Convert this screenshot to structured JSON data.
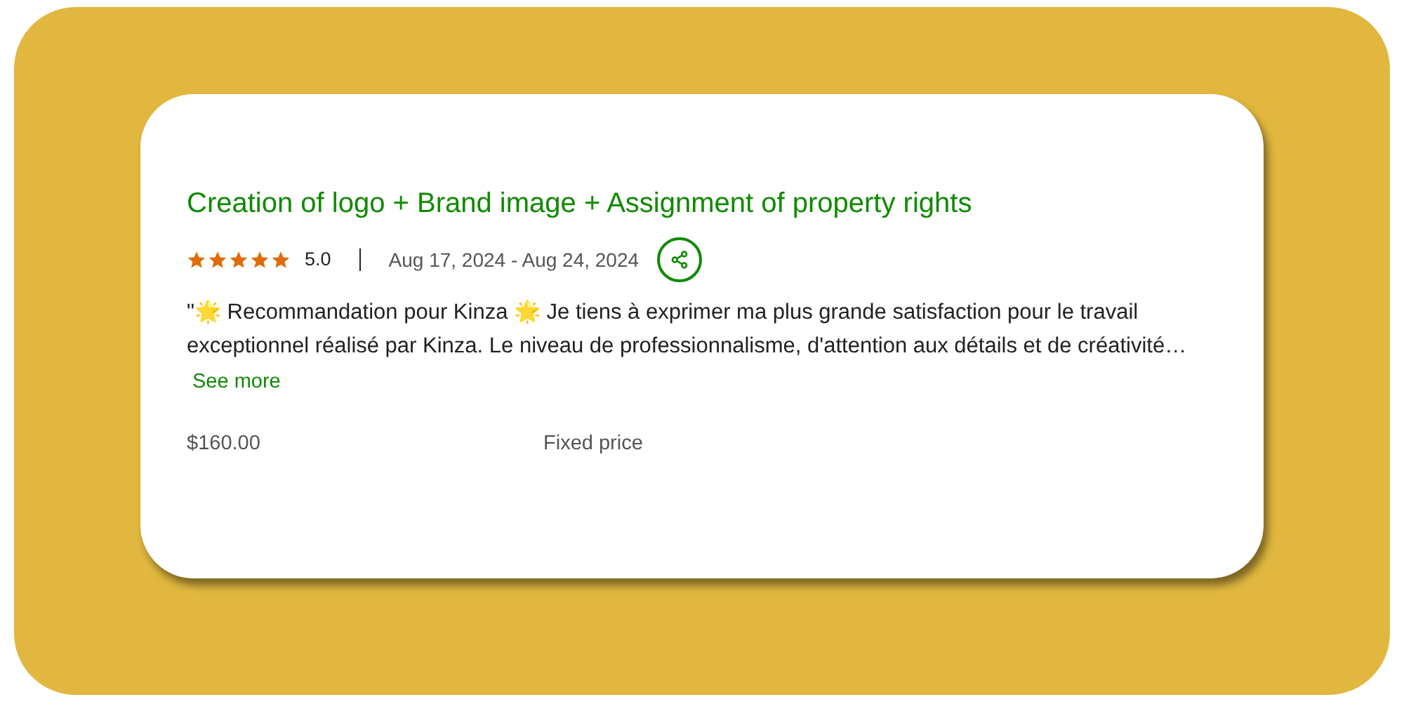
{
  "review": {
    "title": "Creation of logo + Brand image + Assignment of property rights",
    "stars": 5,
    "rating": "5.0",
    "dates": "Aug 17, 2024 - Aug 24, 2024",
    "text": "\"🌟 Recommandation pour Kinza 🌟 Je tiens à exprimer ma plus grande satisfaction pour le travail exceptionnel réalisé par Kinza. Le niveau de professionnalisme, d'attention aux détails et de créativité…",
    "see_more": "See more",
    "price": "$160.00",
    "price_type": "Fixed price"
  }
}
